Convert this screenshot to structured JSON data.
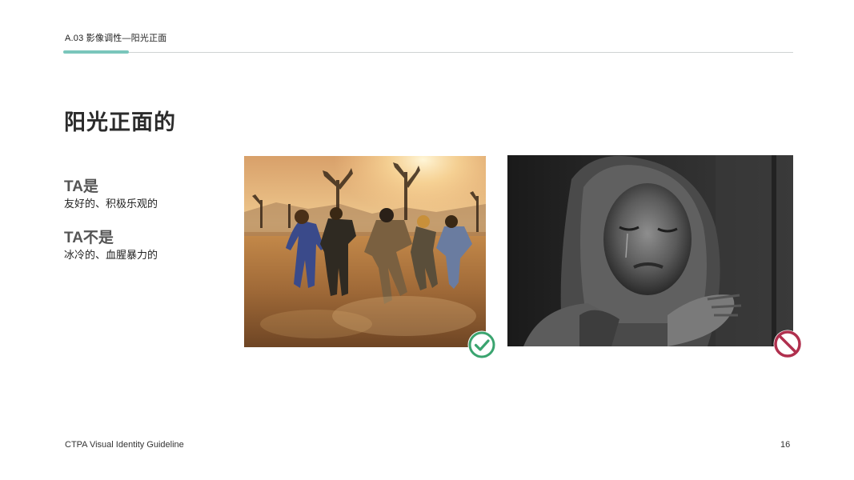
{
  "header": {
    "section_label": "A.03   影像调性—阳光正面"
  },
  "main": {
    "title": "阳光正面的",
    "is": {
      "heading": "TA是",
      "text": "友好的、积极乐观的"
    },
    "is_not": {
      "heading": "TA不是",
      "text": "冰冷的、血腥暴力的"
    }
  },
  "images": {
    "good": {
      "icon": "check-circle-icon",
      "color": "#3aa46f"
    },
    "bad": {
      "icon": "prohibited-icon",
      "color": "#b0304e"
    }
  },
  "footer": {
    "brand": "CTPA Visual Identity Guideline",
    "page_number": "16"
  },
  "colors": {
    "accent": "#7ac6bb",
    "rule": "#cfd3d3"
  }
}
